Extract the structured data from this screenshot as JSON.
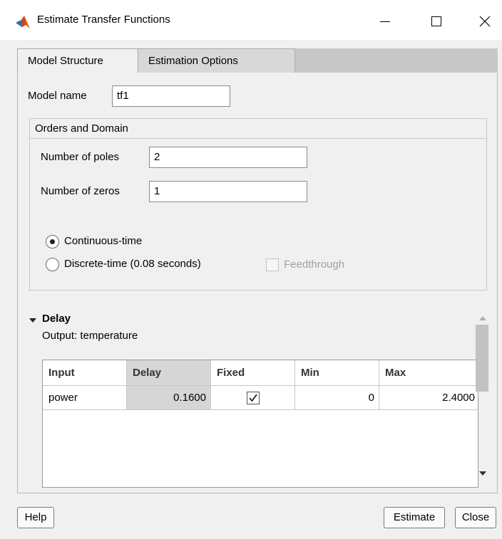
{
  "window": {
    "title": "Estimate Transfer Functions",
    "app_icon": "matlab-membrane-icon",
    "controls": [
      "minimize-icon",
      "maximize-icon",
      "close-icon"
    ]
  },
  "tabs": [
    {
      "label": "Model Structure",
      "active": true
    },
    {
      "label": "Estimation Options",
      "active": false
    }
  ],
  "model": {
    "name_label": "Model name",
    "name_value": "tf1"
  },
  "orders": {
    "header": "Orders and Domain",
    "poles_label": "Number of poles",
    "poles_value": "2",
    "zeros_label": "Number of zeros",
    "zeros_value": "1",
    "continuous_label": "Continuous-time",
    "continuous_selected": true,
    "discrete_label": "Discrete-time (0.08 seconds)",
    "discrete_selected": false,
    "feedthrough_label": "Feedthrough",
    "feedthrough_checked": false
  },
  "delay": {
    "header": "Delay",
    "output_label": "Output: temperature",
    "table": {
      "headers": [
        "Input",
        "Delay",
        "Fixed",
        "Min",
        "Max"
      ],
      "rows": [
        {
          "input": "power",
          "delay": "0.1600",
          "fixed": true,
          "min": "0",
          "max": "2.4000"
        }
      ]
    }
  },
  "buttons": {
    "help": "Help",
    "estimate": "Estimate",
    "close": "Close"
  },
  "colors": {
    "panel_bg": "#f0f0f0",
    "tab_strip": "#c8c8c8",
    "selected_column": "#d6d6d6",
    "matlab_orange": "#e2660c"
  }
}
